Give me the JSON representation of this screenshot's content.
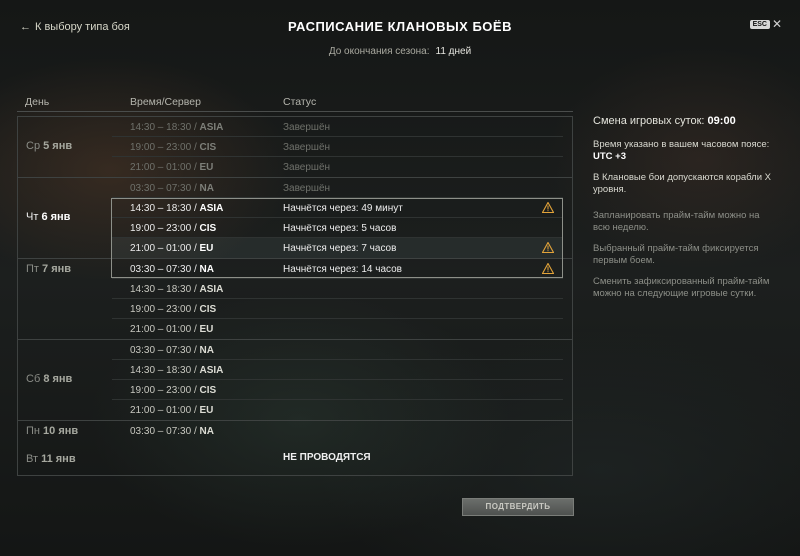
{
  "header": {
    "back_label": "К выбору типа боя",
    "title": "РАСПИСАНИЕ КЛАНОВЫХ БОЁВ",
    "season_label": "До окончания сезона:",
    "season_value": "11 дней",
    "esc_label": "ESC",
    "close_glyph": "✕"
  },
  "columns": {
    "day": "День",
    "time": "Время/Сервер",
    "status": "Статус"
  },
  "days": [
    {
      "weekday": "Ср",
      "date": "5 янв",
      "rows": [
        {
          "time": "14:30 – 18:30 / ",
          "server": "ASIA",
          "status": "Завершён"
        },
        {
          "time": "19:00 – 23:00 / ",
          "server": "CIS",
          "status": "Завершён"
        },
        {
          "time": "21:00 – 01:00 / ",
          "server": "EU",
          "status": "Завершён"
        }
      ]
    },
    {
      "weekday": "Чт",
      "date": "6 янв",
      "rows": [
        {
          "time": "03:30 – 07:30 / ",
          "server": "NA",
          "status": "Завершён"
        },
        {
          "time": "14:30 – 18:30 / ",
          "server": "ASIA",
          "status": "Начнётся через: 49 минут",
          "warning": true
        },
        {
          "time": "19:00 – 23:00 / ",
          "server": "CIS",
          "status": "Начнётся через: 5 часов"
        },
        {
          "time": "21:00 – 01:00 / ",
          "server": "EU",
          "status": "Начнётся через: 7 часов",
          "warning": true
        }
      ]
    },
    {
      "weekday": "Пт",
      "date": "7 янв",
      "rows": [
        {
          "time": "03:30 – 07:30 / ",
          "server": "NA",
          "status": "Начнётся через: 14 часов",
          "warning": true
        },
        {
          "time": "14:30 – 18:30 / ",
          "server": "ASIA",
          "status": ""
        },
        {
          "time": "19:00 – 23:00 / ",
          "server": "CIS",
          "status": ""
        },
        {
          "time": "21:00 – 01:00 / ",
          "server": "EU",
          "status": ""
        }
      ]
    },
    {
      "weekday": "Сб",
      "date": "8 янв",
      "rows": [
        {
          "time": "03:30 – 07:30 / ",
          "server": "NA",
          "status": ""
        },
        {
          "time": "14:30 – 18:30 / ",
          "server": "ASIA",
          "status": ""
        },
        {
          "time": "19:00 – 23:00 / ",
          "server": "CIS",
          "status": ""
        },
        {
          "time": "21:00 – 01:00 / ",
          "server": "EU",
          "status": ""
        }
      ]
    },
    {
      "weekday": "Пн",
      "date": "10 янв",
      "rows": [
        {
          "time": "03:30 – 07:30 / ",
          "server": "NA",
          "status": ""
        }
      ]
    }
  ],
  "no_battles": {
    "weekday": "Вт",
    "date": "11 янв",
    "text": "НЕ ПРОВОДЯТСЯ"
  },
  "side_panel": {
    "day_change_label": "Смена игровых суток:",
    "day_change_value": "09:00",
    "tz_label": "Время указано в вашем часовом поясе:",
    "tz_value": "UTC +3",
    "tier_note": "В Клановые бои допускаются корабли X уровня.",
    "note_1": "Запланировать прайм-тайм можно на всю неделю.",
    "note_2": "Выбранный прайм-тайм фиксируется первым боем.",
    "note_3": "Сменить зафиксированный прайм-тайм можно на следующие игровые сутки."
  },
  "confirm_label": "ПОДТВЕРДИТЬ",
  "colors": {
    "warning": "#e2a33a",
    "accent_text": "#ffffff"
  }
}
